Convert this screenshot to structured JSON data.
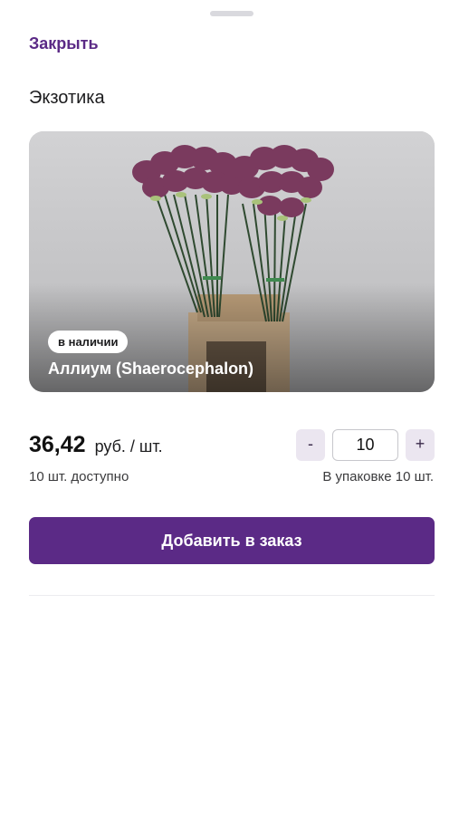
{
  "header": {
    "close_label": "Закрыть"
  },
  "product": {
    "category": "Экзотика",
    "stock_badge": "в наличии",
    "name": "Аллиум (Shaerocephalon)",
    "price": "36,42",
    "price_unit": "руб. / шт.",
    "available": "10 шт. доступно",
    "pack_info": "В упаковке 10 шт."
  },
  "quantity": {
    "minus_label": "-",
    "value": "10",
    "plus_label": "+"
  },
  "actions": {
    "add_to_order_label": "Добавить в заказ"
  },
  "colors": {
    "accent": "#5b2a86",
    "stepper_bg": "#ebe6f0"
  }
}
